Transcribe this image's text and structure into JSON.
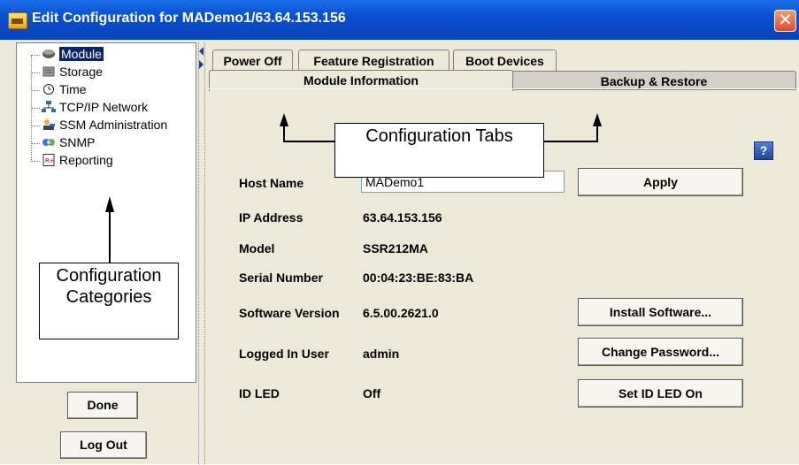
{
  "window": {
    "title": "Edit Configuration for MADemo1/63.64.153.156",
    "close_glyph": "✕"
  },
  "categories": [
    {
      "label": "Module",
      "icon": "module-icon",
      "selected": true
    },
    {
      "label": "Storage",
      "icon": "storage-icon",
      "selected": false
    },
    {
      "label": "Time",
      "icon": "clock-icon",
      "selected": false
    },
    {
      "label": "TCP/IP Network",
      "icon": "network-icon",
      "selected": false
    },
    {
      "label": "SSM Administration",
      "icon": "admin-icon",
      "selected": false
    },
    {
      "label": "SNMP",
      "icon": "snmp-icon",
      "selected": false
    },
    {
      "label": "Reporting",
      "icon": "report-icon",
      "selected": false
    }
  ],
  "left_buttons": {
    "done": "Done",
    "logout": "Log Out"
  },
  "tabs": {
    "row1": [
      "Power Off",
      "Feature Registration",
      "Boot Devices"
    ],
    "row2": [
      "Module Information",
      "Backup & Restore"
    ],
    "active": "Module Information"
  },
  "help_glyph": "?",
  "fields": {
    "host_name": {
      "label": "Host Name",
      "value": "MADemo1"
    },
    "ip_address": {
      "label": "IP Address",
      "value": "63.64.153.156"
    },
    "model": {
      "label": "Model",
      "value": "SSR212MA"
    },
    "serial_number": {
      "label": "Serial Number",
      "value": "00:04:23:BE:83:BA"
    },
    "software_version": {
      "label": "Software Version",
      "value": "6.5.00.2621.0"
    },
    "logged_in_user": {
      "label": "Logged In User",
      "value": "admin"
    },
    "id_led": {
      "label": "ID LED",
      "value": "Off"
    }
  },
  "buttons": {
    "apply": "Apply",
    "install_software": "Install Software...",
    "change_password": "Change Password...",
    "set_id_led": "Set ID LED On"
  },
  "callouts": {
    "tabs": "Configuration Tabs",
    "categories_line1": "Configuration",
    "categories_line2": "Categories"
  },
  "colors": {
    "titlebar": "#0a4fd0",
    "selection": "#0a246a"
  }
}
